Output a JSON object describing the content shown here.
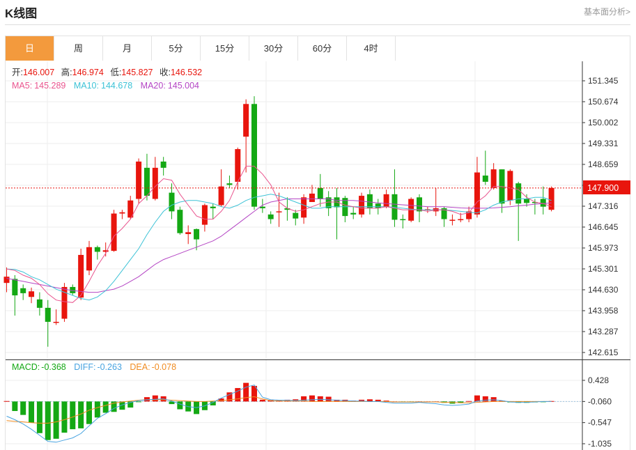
{
  "header": {
    "title": "K线图",
    "link_text": "基本面分析>"
  },
  "tabs": [
    {
      "label": "日",
      "active": true
    },
    {
      "label": "周",
      "active": false
    },
    {
      "label": "月",
      "active": false
    },
    {
      "label": "5分",
      "active": false
    },
    {
      "label": "15分",
      "active": false
    },
    {
      "label": "30分",
      "active": false
    },
    {
      "label": "60分",
      "active": false
    },
    {
      "label": "4时",
      "active": false
    }
  ],
  "info": {
    "open_label": "开:",
    "open": "146.007",
    "high_label": "高:",
    "high": "146.974",
    "low_label": "低:",
    "low": "145.827",
    "close_label": "收:",
    "close": "146.532",
    "ma5_label": "MA5:",
    "ma5": "145.289",
    "ma10_label": "MA10:",
    "ma10": "144.678",
    "ma20_label": "MA20:",
    "ma20": "145.004",
    "macd_label": "MACD:",
    "macd": "-0.368",
    "diff_label": "DIFF:",
    "diff": "-0.263",
    "dea_label": "DEA:",
    "dea": "-0.078",
    "current_price": "147.900"
  },
  "colors": {
    "up": "#e8150d",
    "down": "#14a814",
    "ma5": "#e9548e",
    "ma10": "#3cc2d6",
    "ma20": "#b445c4",
    "diff": "#47a3e0",
    "dea": "#f08c22",
    "accent": "#f39a3d"
  },
  "chart_data": {
    "type": "candlestick",
    "price_axis": {
      "ticks": [
        "151.345",
        "150.674",
        "150.002",
        "149.331",
        "148.659",
        "147.988",
        "147.316",
        "146.645",
        "145.973",
        "145.301",
        "144.630",
        "143.958",
        "143.287",
        "142.615"
      ],
      "range": [
        142.615,
        151.345
      ]
    },
    "macd_axis": {
      "ticks": [
        "0.428",
        "-0.060",
        "-0.547",
        "-1.035"
      ],
      "range": [
        -1.035,
        0.428
      ]
    },
    "candles": [
      [
        144.85,
        145.05,
        145.35,
        144.55
      ],
      [
        144.98,
        144.45,
        145.1,
        143.8
      ],
      [
        144.68,
        144.52,
        144.8,
        144.3
      ],
      [
        144.4,
        144.58,
        144.7,
        144.2
      ],
      [
        144.32,
        144.05,
        144.55,
        143.8
      ],
      [
        144.05,
        143.6,
        144.3,
        142.8
      ],
      [
        143.6,
        143.6,
        144.0,
        143.5
      ],
      [
        143.7,
        144.72,
        144.85,
        143.6
      ],
      [
        144.72,
        144.52,
        144.8,
        144.45
      ],
      [
        144.38,
        145.75,
        145.95,
        144.3
      ],
      [
        145.25,
        146.0,
        146.2,
        145.1
      ],
      [
        146.0,
        145.85,
        146.05,
        145.6
      ],
      [
        145.85,
        145.9,
        146.15,
        145.7
      ],
      [
        145.88,
        147.08,
        147.2,
        145.85
      ],
      [
        147.08,
        147.12,
        147.2,
        146.9
      ],
      [
        146.95,
        147.5,
        147.65,
        146.9
      ],
      [
        147.55,
        148.75,
        148.85,
        147.4
      ],
      [
        148.55,
        147.65,
        149.0,
        147.5
      ],
      [
        147.55,
        148.55,
        148.9,
        147.5
      ],
      [
        148.75,
        148.55,
        148.9,
        148.3
      ],
      [
        147.75,
        147.15,
        148.05,
        146.9
      ],
      [
        147.2,
        146.45,
        147.3,
        146.4
      ],
      [
        146.42,
        146.48,
        146.7,
        146.1
      ],
      [
        146.58,
        146.25,
        146.6,
        145.9
      ],
      [
        146.72,
        147.35,
        147.4,
        146.5
      ],
      [
        147.3,
        147.25,
        147.4,
        146.9
      ],
      [
        147.35,
        147.95,
        148.5,
        147.3
      ],
      [
        148.05,
        148.0,
        148.3,
        147.9
      ],
      [
        148.1,
        149.15,
        149.2,
        147.85
      ],
      [
        149.55,
        150.6,
        150.75,
        148.4
      ],
      [
        150.6,
        147.3,
        150.85,
        147.2
      ],
      [
        147.3,
        147.25,
        147.55,
        147.1
      ],
      [
        147.05,
        146.9,
        147.15,
        146.75
      ],
      [
        147.15,
        147.15,
        147.75,
        146.65
      ],
      [
        147.25,
        147.2,
        147.6,
        146.85
      ],
      [
        147.1,
        146.92,
        147.2,
        146.7
      ],
      [
        146.95,
        147.6,
        147.7,
        146.75
      ],
      [
        147.45,
        147.72,
        148.0,
        147.45
      ],
      [
        147.9,
        147.55,
        148.35,
        147.3
      ],
      [
        147.6,
        147.25,
        147.8,
        147.0
      ],
      [
        147.6,
        147.28,
        147.9,
        146.25
      ],
      [
        147.58,
        147.0,
        147.65,
        146.8
      ],
      [
        147.1,
        147.05,
        147.3,
        146.9
      ],
      [
        147.05,
        147.65,
        147.75,
        146.95
      ],
      [
        147.7,
        147.25,
        147.85,
        147.05
      ],
      [
        147.4,
        147.25,
        147.55,
        147.05
      ],
      [
        147.3,
        147.7,
        147.85,
        147.25
      ],
      [
        147.7,
        146.88,
        148.5,
        146.65
      ],
      [
        146.9,
        146.88,
        147.05,
        146.6
      ],
      [
        146.85,
        147.55,
        147.6,
        146.8
      ],
      [
        147.6,
        147.15,
        147.7,
        146.8
      ],
      [
        147.2,
        147.22,
        147.3,
        147.1
      ],
      [
        147.15,
        147.25,
        147.9,
        147.0
      ],
      [
        147.25,
        146.9,
        147.3,
        146.65
      ],
      [
        146.85,
        146.88,
        147.05,
        146.7
      ],
      [
        146.9,
        146.9,
        147.1,
        146.8
      ],
      [
        146.9,
        147.15,
        147.3,
        146.8
      ],
      [
        147.05,
        148.4,
        148.9,
        146.95
      ],
      [
        148.3,
        148.1,
        149.1,
        148.0
      ],
      [
        147.9,
        148.5,
        148.7,
        147.85
      ],
      [
        148.5,
        147.4,
        148.5,
        147.1
      ],
      [
        147.5,
        148.45,
        148.5,
        147.35
      ],
      [
        148.05,
        147.4,
        148.1,
        146.2
      ],
      [
        147.55,
        147.42,
        147.7,
        147.3
      ],
      [
        147.45,
        147.42,
        147.55,
        147.05
      ],
      [
        147.55,
        147.3,
        147.95,
        147.05
      ],
      [
        147.2,
        147.9,
        147.95,
        147.15
      ]
    ],
    "ma5": [
      145.3,
      145.25,
      145.1,
      145.0,
      144.8,
      144.5,
      144.3,
      144.25,
      144.22,
      144.45,
      144.9,
      145.4,
      145.8,
      146.35,
      146.6,
      146.9,
      147.4,
      147.65,
      147.95,
      148.2,
      148.15,
      147.7,
      147.35,
      147.0,
      146.9,
      146.9,
      147.15,
      147.5,
      148.1,
      148.6,
      148.6,
      148.35,
      148.0,
      147.45,
      147.25,
      147.15,
      147.2,
      147.3,
      147.4,
      147.45,
      147.45,
      147.35,
      147.3,
      147.25,
      147.25,
      147.25,
      147.3,
      147.25,
      147.2,
      147.2,
      147.2,
      147.15,
      147.2,
      147.2,
      147.15,
      147.05,
      147.1,
      147.45,
      147.65,
      147.95,
      147.95,
      147.9,
      147.85,
      147.6,
      147.45,
      147.4,
      147.3
    ],
    "ma10": [
      145.3,
      145.28,
      145.2,
      145.05,
      144.95,
      144.8,
      144.65,
      144.55,
      144.45,
      144.35,
      144.3,
      144.4,
      144.6,
      144.9,
      145.25,
      145.6,
      145.95,
      146.4,
      146.8,
      147.15,
      147.35,
      147.45,
      147.5,
      147.5,
      147.45,
      147.4,
      147.3,
      147.25,
      147.35,
      147.5,
      147.6,
      147.65,
      147.7,
      147.65,
      147.55,
      147.45,
      147.35,
      147.25,
      147.25,
      147.3,
      147.3,
      147.3,
      147.3,
      147.3,
      147.3,
      147.3,
      147.3,
      147.28,
      147.25,
      147.22,
      147.2,
      147.2,
      147.2,
      147.2,
      147.18,
      147.15,
      147.12,
      147.1,
      147.2,
      147.35,
      147.45,
      147.5,
      147.55,
      147.55,
      147.6,
      147.6,
      147.5
    ],
    "ma20": [
      145.0,
      144.95,
      144.9,
      144.85,
      144.8,
      144.75,
      144.7,
      144.65,
      144.6,
      144.58,
      144.55,
      144.55,
      144.6,
      144.65,
      144.75,
      144.9,
      145.05,
      145.25,
      145.45,
      145.6,
      145.7,
      145.8,
      145.9,
      146.0,
      146.1,
      146.2,
      146.35,
      146.55,
      146.75,
      146.95,
      147.15,
      147.35,
      147.45,
      147.5,
      147.55,
      147.55,
      147.55,
      147.55,
      147.55,
      147.55,
      147.5,
      147.5,
      147.5,
      147.48,
      147.45,
      147.42,
      147.4,
      147.38,
      147.36,
      147.34,
      147.32,
      147.3,
      147.3,
      147.3,
      147.28,
      147.26,
      147.25,
      147.25,
      147.25,
      147.26,
      147.28,
      147.3,
      147.33,
      147.35,
      147.38,
      147.4,
      147.42
    ],
    "macd": [
      -0.05,
      -0.28,
      -0.37,
      -0.55,
      -0.79,
      -0.95,
      -0.92,
      -0.78,
      -0.7,
      -0.68,
      -0.58,
      -0.43,
      -0.32,
      -0.3,
      -0.25,
      -0.2,
      -0.07,
      0.04,
      0.08,
      0.06,
      -0.12,
      -0.24,
      -0.29,
      -0.35,
      -0.26,
      -0.15,
      0.01,
      0.15,
      0.25,
      0.37,
      0.3,
      -0.02,
      -0.03,
      -0.03,
      -0.02,
      -0.01,
      0.06,
      0.08,
      0.06,
      0.05,
      -0.02,
      -0.02,
      -0.04,
      -0.02,
      -0.01,
      -0.02,
      -0.04,
      -0.06,
      -0.07,
      -0.07,
      -0.06,
      -0.06,
      -0.06,
      -0.09,
      -0.11,
      -0.09,
      -0.05,
      0.08,
      0.06,
      0.04,
      -0.04,
      -0.08,
      -0.09,
      -0.09,
      -0.08,
      -0.07,
      -0.05
    ],
    "diff": [
      -0.4,
      -0.48,
      -0.58,
      -0.7,
      -0.84,
      -0.98,
      -1.0,
      -0.95,
      -0.9,
      -0.8,
      -0.62,
      -0.45,
      -0.34,
      -0.22,
      -0.14,
      -0.08,
      -0.04,
      -0.02,
      -0.01,
      0.0,
      -0.05,
      -0.12,
      -0.18,
      -0.2,
      -0.16,
      -0.08,
      0.02,
      0.1,
      0.18,
      0.27,
      0.32,
      0.04,
      -0.02,
      -0.03,
      -0.03,
      -0.04,
      -0.03,
      -0.02,
      -0.01,
      -0.02,
      -0.03,
      -0.04,
      -0.05,
      -0.05,
      -0.06,
      -0.06,
      -0.08,
      -0.1,
      -0.1,
      -0.1,
      -0.08,
      -0.1,
      -0.11,
      -0.14,
      -0.15,
      -0.14,
      -0.12,
      -0.05,
      -0.03,
      -0.02,
      -0.04,
      -0.07,
      -0.08,
      -0.08,
      -0.07,
      -0.06,
      -0.06
    ],
    "dea": [
      -0.5,
      -0.52,
      -0.53,
      -0.55,
      -0.56,
      -0.56,
      -0.53,
      -0.48,
      -0.42,
      -0.35,
      -0.26,
      -0.2,
      -0.15,
      -0.1,
      -0.07,
      -0.05,
      -0.03,
      -0.02,
      -0.02,
      -0.02,
      -0.03,
      -0.04,
      -0.05,
      -0.06,
      -0.06,
      -0.05,
      -0.04,
      -0.02,
      0.0,
      0.03,
      0.05,
      0.0,
      -0.04,
      -0.05,
      -0.05,
      -0.05,
      -0.05,
      -0.06,
      -0.06,
      -0.06,
      -0.06,
      -0.06,
      -0.06,
      -0.06,
      -0.06,
      -0.06,
      -0.06,
      -0.07,
      -0.07,
      -0.07,
      -0.07,
      -0.07,
      -0.07,
      -0.08,
      -0.08,
      -0.09,
      -0.09,
      -0.08,
      -0.07,
      -0.06,
      -0.06,
      -0.06,
      -0.06,
      -0.06,
      -0.06,
      -0.06,
      -0.06
    ]
  }
}
